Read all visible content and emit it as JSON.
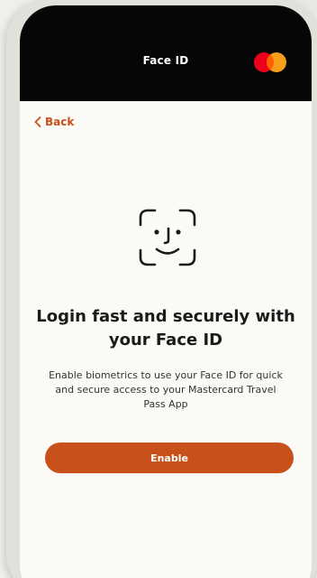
{
  "header": {
    "title": "Face ID",
    "logo_icon": "mastercard-logo"
  },
  "nav": {
    "back_label": "Back",
    "back_icon": "chevron-left-icon"
  },
  "content": {
    "icon": "face-id-icon",
    "headline": "Login fast and securely with your Face ID",
    "description": "Enable biometrics to use your Face ID for quick and secure access to your Mastercard Travel Pass App"
  },
  "actions": {
    "enable_label": "Enable"
  },
  "colors": {
    "accent": "#c8501a",
    "header_bg": "#060606",
    "screen_bg": "#fbfaf7",
    "mastercard_red": "#eb001b",
    "mastercard_yellow": "#f79e1b",
    "mastercard_orange": "#ff5f00"
  }
}
